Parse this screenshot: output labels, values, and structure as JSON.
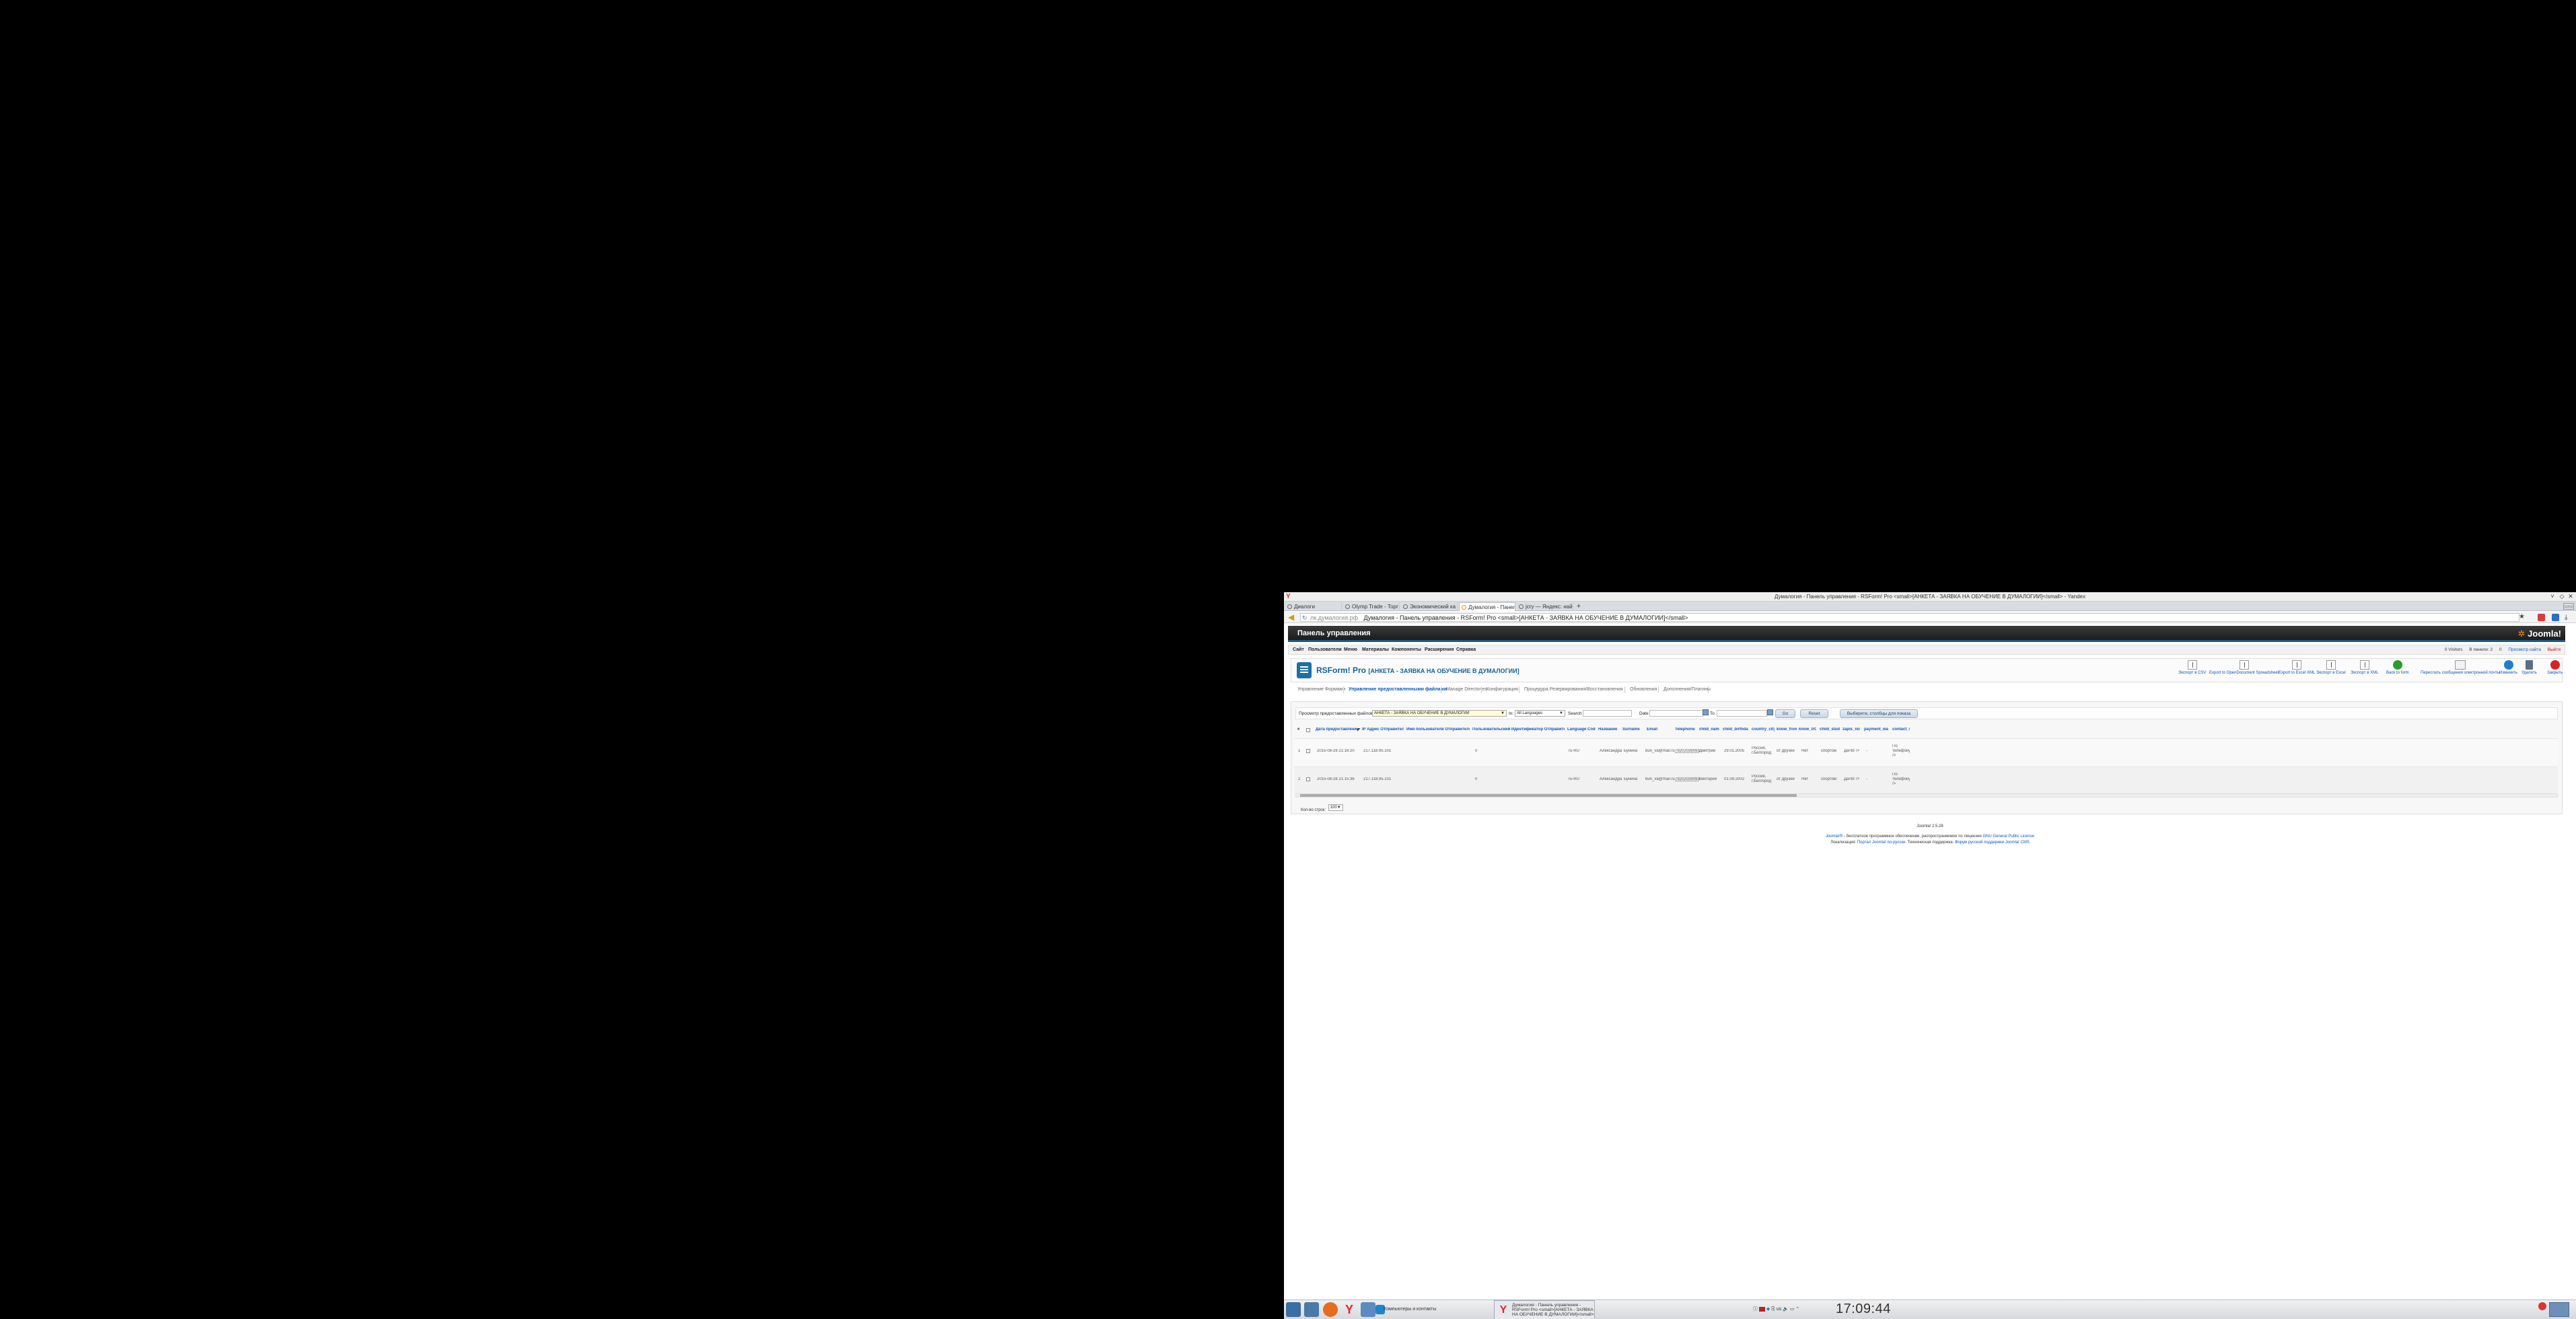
{
  "window": {
    "title": "Думалогия - Панель управления - RSForm! Pro <small>[АНКЕТА - ЗАЯВКА НА ОБУЧЕНИЕ В ДУМАЛОГИИ]</small> - Yandex"
  },
  "tabs": [
    {
      "label": "Диалоги",
      "active": false
    },
    {
      "label": "Olymp Trade - Торг",
      "active": false
    },
    {
      "label": "Экономический ка",
      "active": false
    },
    {
      "label": "Думалогия - Панел",
      "active": true
    },
    {
      "label": "jcry — Яндекс: най",
      "active": false
    }
  ],
  "address": {
    "domain": "лк.думалогия.рф",
    "text": "Думалогия - Панель управления - RSForm! Pro <small>[АНКЕТА - ЗАЯВКА НА ОБУЧЕНИЕ В ДУМАЛОГИИ]</small>"
  },
  "header": {
    "title": "Панель управления",
    "logo": "Joomla!"
  },
  "menu": {
    "items": [
      "Сайт",
      "Пользователи",
      "Меню",
      "Материалы",
      "Компоненты",
      "Расширения",
      "Справка"
    ],
    "visitors": "0 Visitors",
    "admins": "В панели: 2",
    "messages": "0",
    "preview": "Просмотр сайта",
    "logout": "Выйти"
  },
  "toolbar": {
    "title": "RSForm! Pro",
    "subtitle": "[АНКЕТА - ЗАЯВКА НА ОБУЧЕНИЕ В ДУМАЛОГИИ]",
    "buttons": [
      "Экспорт в CSV",
      "Export to OpenDocument Spreadsheet",
      "Export to Excel XML",
      "Экспорт в Excel",
      "Экспорт в XML",
      "Back to form",
      "Переслать сообщения электронной почты",
      "Изменить",
      "Удалить",
      "Закрыть"
    ]
  },
  "subnav": [
    "Управление Формами",
    "Управление предоставленными файлами",
    "Manage Directories",
    "Конфигурация",
    "Процедура Резервирования/Восстановления",
    "Обновления",
    "Дополнения/Плагины"
  ],
  "filters": {
    "view_label": "Просмотр предоставленных файлов по:",
    "form_value": "АНКЕТА - ЗАЯВКА НА ОБУЧЕНИЕ В ДУМАЛОГИИ",
    "in_label": "In:",
    "lang_value": "All Languages",
    "search_label": "Search",
    "date_label": "Date",
    "to_label": "To",
    "go": "Go",
    "reset": "Reset",
    "columns_btn": "Выберите, столбцы для показа"
  },
  "table": {
    "headers": [
      "#",
      "Дата предоставления",
      "IP Адрес Отправителя",
      "Имя пользователя Отправителя",
      "Пользовательский Идентификатор Отправителя",
      "Language Code",
      "Название",
      "Surname",
      "Email",
      "Telephone",
      "child_name",
      "child_birthday",
      "country_city",
      "know_from",
      "know_trtz",
      "child_study",
      "zapis_now",
      "payment_way",
      "contact_w"
    ],
    "rows": [
      [
        "1",
        "2015-08-28 21:16:20",
        "217.118.95.101",
        "",
        "0",
        "ru-RU",
        "Александра",
        "Бунина",
        "bun_va@mail.ru",
        "79202039093",
        "Дмитрий",
        "29.01.2005",
        "Россия, г.Белгород",
        "от друзей",
        "Нет",
        "спортом",
        "Да<br />",
        "-",
        "По телефону<br />"
      ],
      [
        "2",
        "2015-08-28 21:15:36",
        "217.118.95.101",
        "",
        "0",
        "ru-RU",
        "Александра",
        "Бунина",
        "bun_va@mail.ru",
        "79202039093",
        "Виктория",
        "01.09.2002",
        "Россия, г.Белгород",
        "от друзей",
        "Нет",
        "спортом",
        "Да<br />",
        "-",
        "По телефону<br />"
      ]
    ]
  },
  "pagination": {
    "label": "Кол-во строк:",
    "value": "100"
  },
  "footer": {
    "version": "Joomla! 2.5.28",
    "line1_a": "Joomla!®",
    "line1_b": " - бесплатное программное обеспечение, распространяемое по лицензии ",
    "line1_c": "GNU General Public License",
    "line2_a": "Локализация: ",
    "line2_b": "Портал Joomla! по-русски",
    "line2_c": ". Техническая поддержка: ",
    "line2_d": "Форум русской поддержки Joomla! CMS"
  },
  "taskbar": {
    "task1": "Компьютеры и контакты",
    "task2": "Думалогия - Панель управления - RSForm! Pro <small>[АНКЕТА - ЗАЯВКА НА ОБУЧЕНИЕ В ДУМАЛОГИИ]</small> - ...",
    "lang": "us",
    "clock": "17:09:44"
  },
  "colors": {
    "accent": "#0b55c4",
    "header_bg": "#1c1c1c",
    "joomla_orange": "#f48a1a"
  }
}
